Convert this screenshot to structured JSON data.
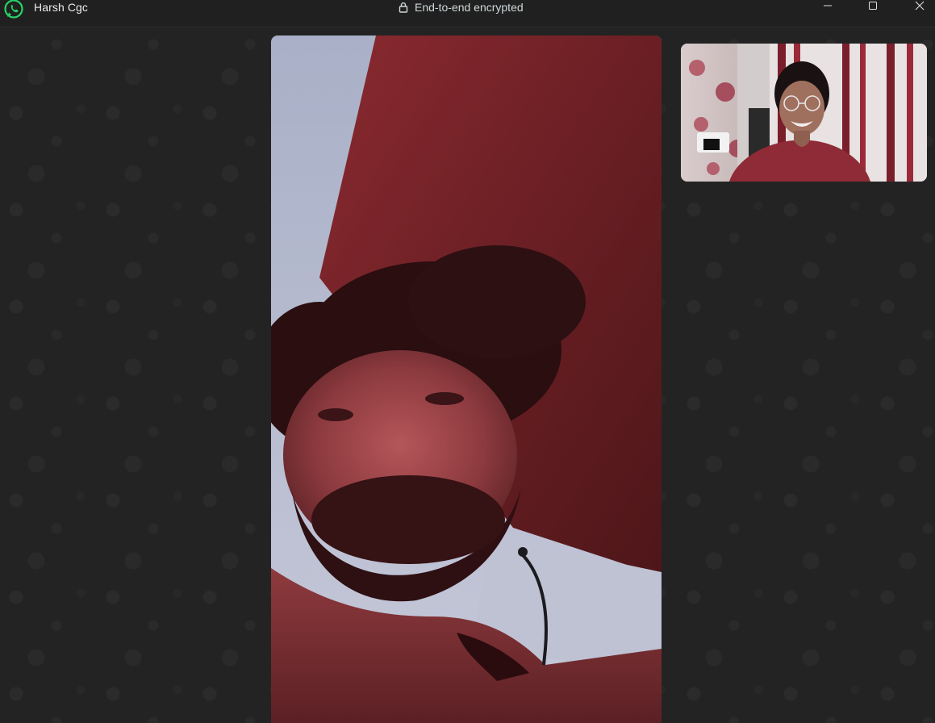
{
  "window": {
    "contact_name": "Harsh Cgc",
    "encryption_label": "End-to-end encrypted",
    "app_icon": "whatsapp-icon",
    "controls": [
      "minimize-icon",
      "maximize-icon",
      "close-icon"
    ]
  },
  "call": {
    "remote_video": "remote-participant-video",
    "self_view": "local-camera-preview"
  },
  "colors": {
    "accent": "#25d366",
    "titlebar": "#202020",
    "background": "#232323"
  }
}
